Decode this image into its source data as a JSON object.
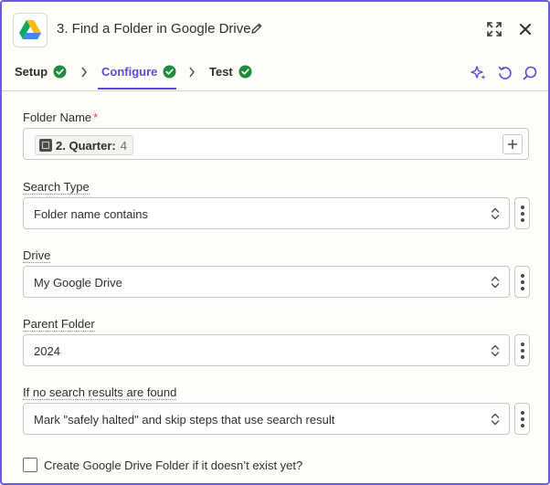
{
  "header": {
    "title": "3. Find a Folder in Google Drive",
    "app_icon": "google-drive-icon",
    "edit_icon": "pencil-icon",
    "expand_icon": "expand-icon",
    "close_icon": "close-icon"
  },
  "tabs": [
    {
      "label": "Setup",
      "status": "complete"
    },
    {
      "label": "Configure",
      "status": "complete",
      "active": true
    },
    {
      "label": "Test",
      "status": "complete"
    }
  ],
  "toolbar": {
    "ai_icon": "sparkle-icon",
    "undo_icon": "refresh-icon",
    "search_icon": "search-icon"
  },
  "fields": {
    "folder_name": {
      "label": "Folder Name",
      "required": "*",
      "pill_label": "2. Quarter:",
      "pill_value": "4"
    },
    "search_type": {
      "label": "Search Type",
      "value": "Folder name contains"
    },
    "drive": {
      "label": "Drive",
      "value": "My Google Drive"
    },
    "parent_folder": {
      "label": "Parent Folder",
      "value": "2024"
    },
    "no_results": {
      "label": "If no search results are found",
      "value": "Mark \"safely halted\" and skip steps that use search result"
    }
  },
  "checkbox": {
    "label": "Create Google Drive Folder if it doesn’t exist yet?",
    "checked": false
  },
  "colors": {
    "accent": "#5a4bd1",
    "success": "#1f8a3b",
    "required": "#e8403a",
    "border": "#6a5bd6"
  }
}
